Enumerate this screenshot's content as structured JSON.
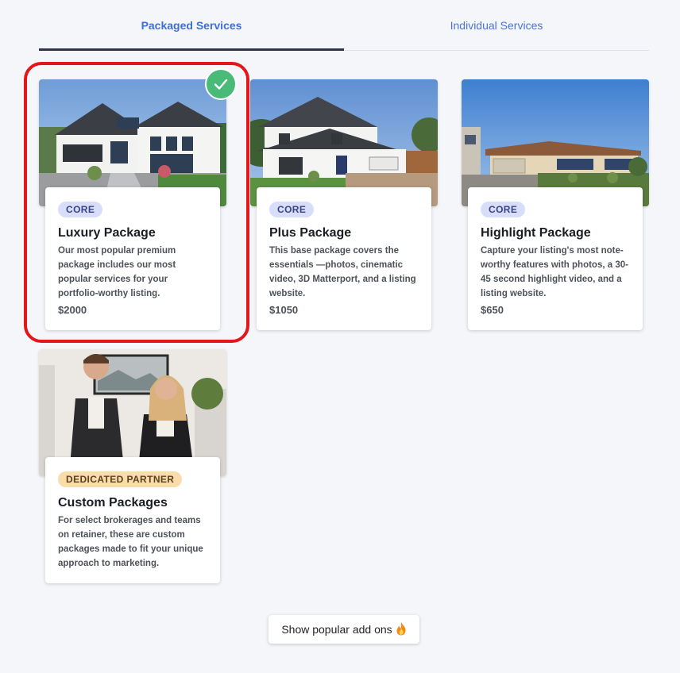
{
  "tabs": {
    "packaged": "Packaged Services",
    "individual": "Individual Services"
  },
  "packages": [
    {
      "badge": "CORE",
      "title": "Luxury Package",
      "description": "Our most popular premium package includes our most popular services for your portfolio-worthy listing.",
      "price": "$2000",
      "selected": true
    },
    {
      "badge": "CORE",
      "title": "Plus Package",
      "description": "This base package covers the essentials —photos, cinematic video, 3D Matterport, and a listing website.",
      "price": "$1050",
      "selected": false
    },
    {
      "badge": "CORE",
      "title": "Highlight Package",
      "description": "Capture your listing's most note-worthy features with photos, a 30-45 second highlight video, and a listing website.",
      "price": "$650",
      "selected": false
    },
    {
      "badge": "DEDICATED PARTNER",
      "title": "Custom Packages",
      "description": "For select brokerages and teams on retainer, these are custom packages made to fit your unique approach to marketing.",
      "price": "",
      "selected": false
    }
  ],
  "addons_button": {
    "label": "Show popular add ons",
    "icon": "fire-icon"
  },
  "colors": {
    "accent": "#3f6fd8",
    "selected_outline": "#e3161b",
    "check": "#4aba79",
    "core_badge": "#d8def9",
    "partner_badge": "#f9dcaa"
  }
}
